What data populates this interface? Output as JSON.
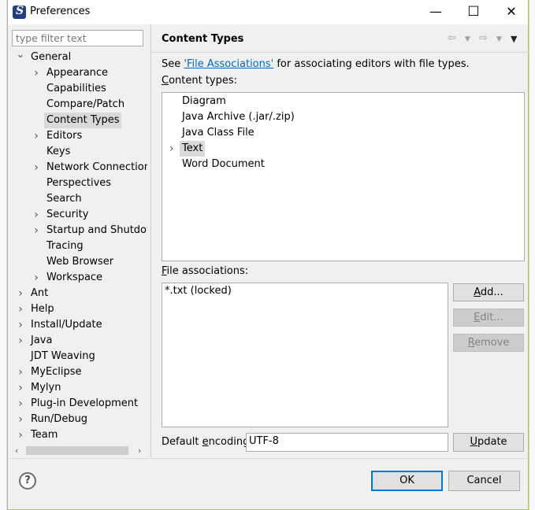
{
  "window": {
    "title": "Preferences",
    "minimize": "—",
    "maximize": "☐",
    "close": "✕"
  },
  "filter": {
    "placeholder": "type filter text"
  },
  "tree": [
    {
      "label": "General",
      "level": 0,
      "exp": "open",
      "row": 0
    },
    {
      "label": "Appearance",
      "level": 1,
      "exp": "closed",
      "row": 1
    },
    {
      "label": "Capabilities",
      "level": 1,
      "exp": "none",
      "row": 2
    },
    {
      "label": "Compare/Patch",
      "level": 1,
      "exp": "none",
      "row": 3
    },
    {
      "label": "Content Types",
      "level": 1,
      "exp": "none",
      "row": 4,
      "selected": true
    },
    {
      "label": "Editors",
      "level": 1,
      "exp": "closed",
      "row": 5
    },
    {
      "label": "Keys",
      "level": 1,
      "exp": "none",
      "row": 6
    },
    {
      "label": "Network Connections",
      "level": 1,
      "exp": "closed",
      "row": 7
    },
    {
      "label": "Perspectives",
      "level": 1,
      "exp": "none",
      "row": 8
    },
    {
      "label": "Search",
      "level": 1,
      "exp": "none",
      "row": 9
    },
    {
      "label": "Security",
      "level": 1,
      "exp": "closed",
      "row": 10
    },
    {
      "label": "Startup and Shutdown",
      "level": 1,
      "exp": "closed",
      "row": 11
    },
    {
      "label": "Tracing",
      "level": 1,
      "exp": "none",
      "row": 12
    },
    {
      "label": "Web Browser",
      "level": 1,
      "exp": "none",
      "row": 13
    },
    {
      "label": "Workspace",
      "level": 1,
      "exp": "closed",
      "row": 14
    },
    {
      "label": "Ant",
      "level": 0,
      "exp": "closed",
      "row": 15
    },
    {
      "label": "Help",
      "level": 0,
      "exp": "closed",
      "row": 16
    },
    {
      "label": "Install/Update",
      "level": 0,
      "exp": "closed",
      "row": 17
    },
    {
      "label": "Java",
      "level": 0,
      "exp": "closed",
      "row": 18
    },
    {
      "label": "JDT Weaving",
      "level": 0,
      "exp": "none",
      "row": 19
    },
    {
      "label": "MyEclipse",
      "level": 0,
      "exp": "closed",
      "row": 20
    },
    {
      "label": "Mylyn",
      "level": 0,
      "exp": "closed",
      "row": 21
    },
    {
      "label": "Plug-in Development",
      "level": 0,
      "exp": "closed",
      "row": 22
    },
    {
      "label": "Run/Debug",
      "level": 0,
      "exp": "closed",
      "row": 23
    },
    {
      "label": "Team",
      "level": 0,
      "exp": "closed",
      "row": 24
    }
  ],
  "page": {
    "title": "Content Types",
    "see_prefix": "See ",
    "see_link": "'File Associations'",
    "see_suffix": " for associating editors with file types.",
    "content_types_label_u": "C",
    "content_types_label_rest": "ontent types:",
    "content_types": [
      {
        "label": "Diagram",
        "exp": "none"
      },
      {
        "label": "Java Archive (.jar/.zip)",
        "exp": "none"
      },
      {
        "label": "Java Class File",
        "exp": "none"
      },
      {
        "label": "Text",
        "exp": "closed",
        "selected": true
      },
      {
        "label": "Word Document",
        "exp": "none"
      }
    ],
    "file_assoc_label_u": "F",
    "file_assoc_label_rest": "ile associations:",
    "file_associations": [
      "*.txt (locked)"
    ],
    "add_u": "A",
    "add_rest": "dd...",
    "edit_u": "E",
    "edit_rest": "dit...",
    "remove_u": "R",
    "remove_rest": "emove",
    "encoding_label_pre": "Default ",
    "encoding_label_u": "e",
    "encoding_label_post": "ncoding:",
    "encoding_value": "UTF-8",
    "update_u": "U",
    "update_rest": "pdate"
  },
  "footer": {
    "help": "?",
    "ok": "OK",
    "cancel": "Cancel"
  }
}
